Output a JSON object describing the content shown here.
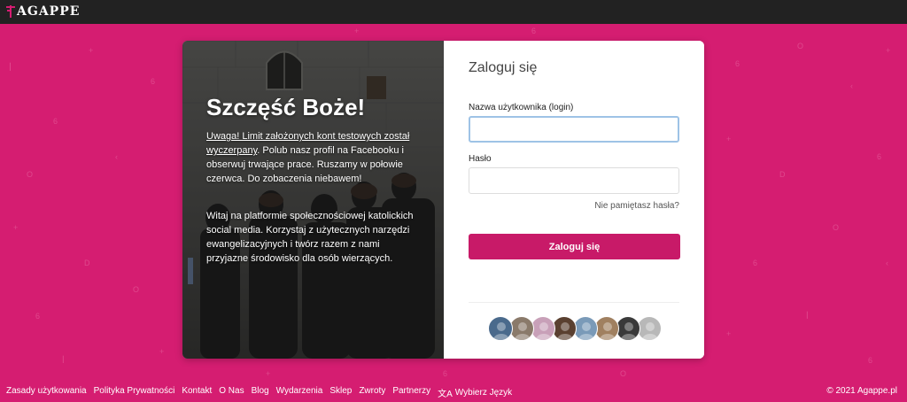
{
  "brand": {
    "name": "AGAPPE"
  },
  "welcome": {
    "title": "Szczęść Boże!",
    "notice_link": "Uwaga! Limit założonych kont testowych został wyczerpany",
    "notice_text": ". Polub nasz profil na Facebooku i obserwuj trwające prace. Ruszamy w połowie czerwca. Do zobaczenia niebawem!",
    "intro": "Witaj na platformie społecznościowej katolickich social media. Korzystaj z użytecznych narzędzi ewangelizacyjnych i twórz razem z nami przyjazne środowisko dla osób wierzących."
  },
  "login": {
    "title": "Zaloguj się",
    "username_label": "Nazwa użytkownika (login)",
    "username_value": "",
    "password_label": "Hasło",
    "password_value": "",
    "forgot": "Nie pamiętasz hasła?",
    "submit": "Zaloguj się"
  },
  "avatars": [
    {
      "name": "avatar-1",
      "color": "#4a6a8c"
    },
    {
      "name": "avatar-2",
      "color": "#8a7a6a"
    },
    {
      "name": "avatar-3",
      "color": "#c8a0b8"
    },
    {
      "name": "avatar-4",
      "color": "#5a4030"
    },
    {
      "name": "avatar-5",
      "color": "#7a9ab8"
    },
    {
      "name": "avatar-6",
      "color": "#a08060"
    },
    {
      "name": "avatar-7",
      "color": "#3a3a3a"
    },
    {
      "name": "avatar-8",
      "color": "#b8b8b8"
    }
  ],
  "footer": {
    "links": [
      "Zasady użytkowania",
      "Polityka Prywatności",
      "Kontakt",
      "O Nas",
      "Blog",
      "Wydarzenia",
      "Sklep",
      "Zwroty",
      "Partnerzy"
    ],
    "language": "Wybierz Język",
    "copyright": "© 2021 Agappe.pl"
  },
  "colors": {
    "background": "#d51d71",
    "topbar": "#222222",
    "button": "#c81a68"
  }
}
